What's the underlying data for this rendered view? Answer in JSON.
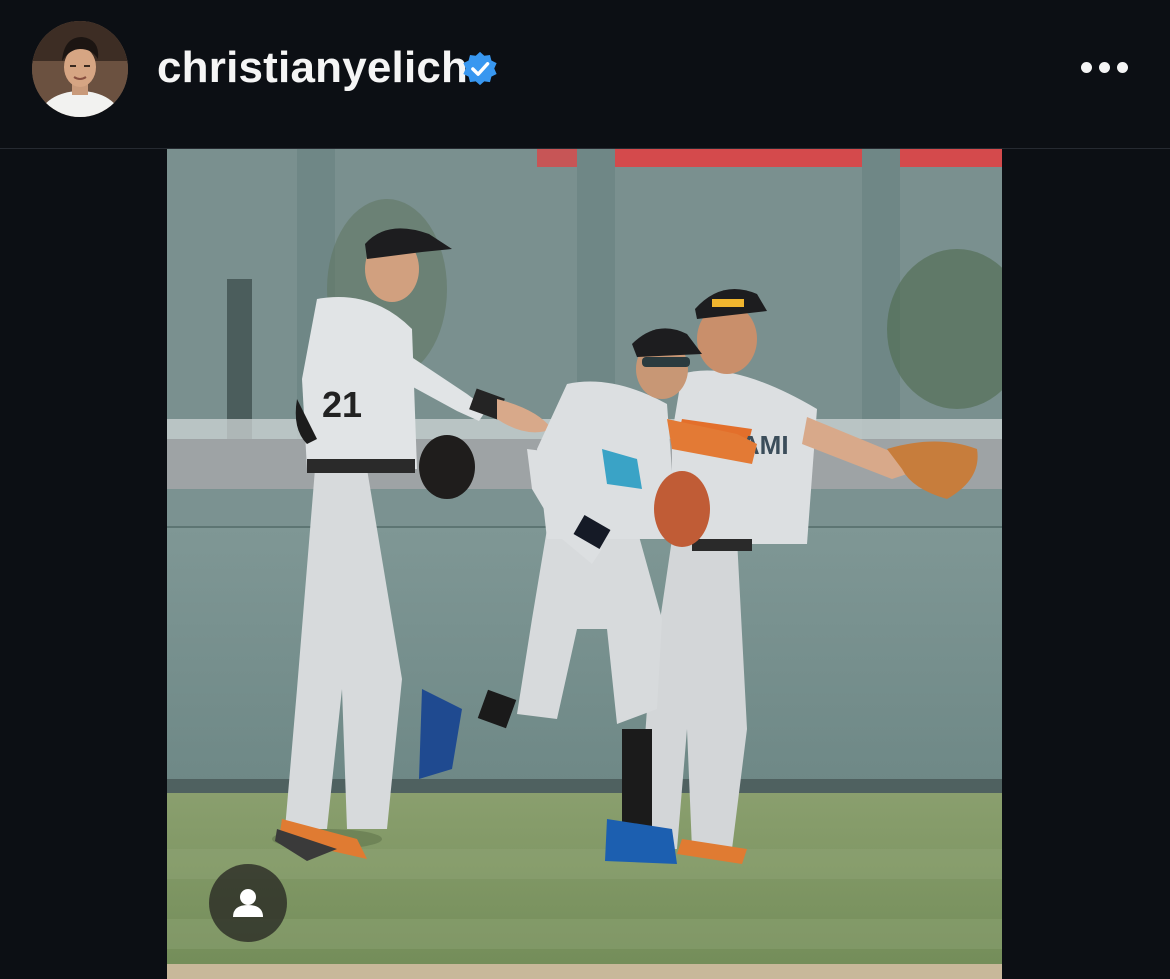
{
  "header": {
    "username": "christianyelich",
    "avatar_icon": "profile-avatar",
    "verified_icon": "verified-badge-icon",
    "verified_color": "#3897f0",
    "more_icon": "more-options-icon"
  },
  "post": {
    "jersey_number": "21",
    "jersey_text": "MIAMI",
    "user_tag_icon": "person-tag-icon"
  }
}
